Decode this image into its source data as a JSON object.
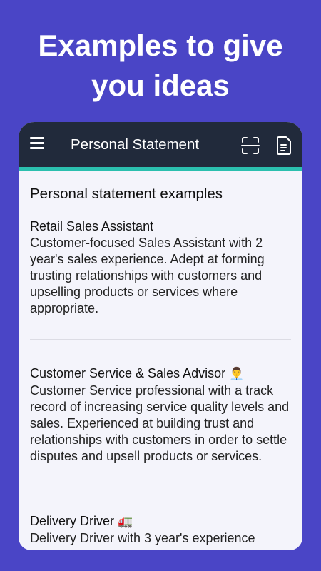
{
  "promo": {
    "headline_line1": "Examples to give",
    "headline_line2": "you ideas"
  },
  "appbar": {
    "title": "Personal Statement",
    "icons": [
      "menu-icon",
      "scan-icon",
      "document-icon"
    ]
  },
  "section": {
    "title": "Personal statement examples"
  },
  "examples": [
    {
      "title": "Retail Sales Assistant",
      "emoji": "",
      "body": "Customer-focused Sales Assistant with 2 year's sales experience. Adept at forming trusting relationships with customers and upselling products or services where appropriate."
    },
    {
      "title": "Customer Service & Sales Advisor",
      "emoji": "👨‍💼",
      "body": "Customer Service professional with a track record of increasing service quality levels and sales. Experienced at building trust and relationships with customers in order to settle disputes and upsell products or services."
    },
    {
      "title": "Delivery Driver",
      "emoji": "🚛",
      "body": "Delivery Driver with 3 year's experience"
    }
  ],
  "colors": {
    "background": "#4a45c6",
    "appbar": "#212a3b",
    "accent": "#2bbfae",
    "card": "#f4f4fb"
  }
}
